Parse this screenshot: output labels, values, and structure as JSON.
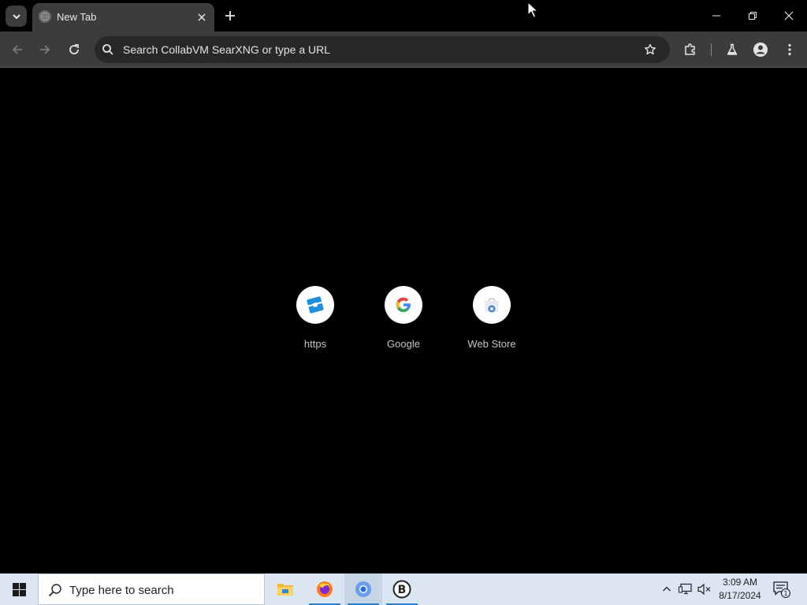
{
  "tab": {
    "title": "New Tab"
  },
  "omnibox": {
    "placeholder": "Search CollabVM SearXNG or type a URL"
  },
  "shortcuts": [
    {
      "label": "https",
      "icon": "roblox-icon"
    },
    {
      "label": "Google",
      "icon": "google-g-icon"
    },
    {
      "label": "Web Store",
      "icon": "chrome-web-store-icon"
    }
  ],
  "taskbar": {
    "search_placeholder": "Type here to search",
    "apps": [
      "file-explorer-icon",
      "firefox-icon",
      "chromium-icon",
      "bloxstrap-icon"
    ],
    "clock_time": "3:09 AM",
    "clock_date": "8/17/2024",
    "notification_count": "1"
  },
  "colors": {
    "page_bg": "#000000",
    "toolbar_bg": "#3c3c3c",
    "omnibox_bg": "#282828",
    "taskbar_bg": "#dbe6f2",
    "accent": "#2b7fd0"
  }
}
